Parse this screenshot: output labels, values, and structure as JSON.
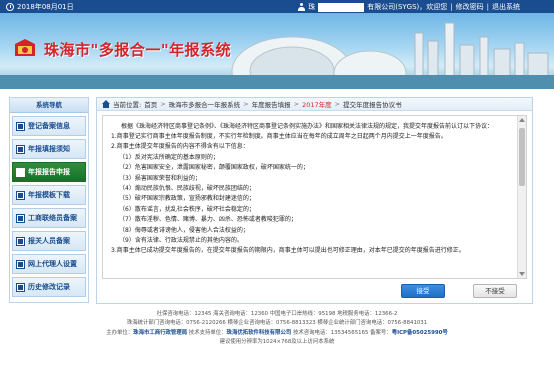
{
  "topbar": {
    "date": "2018年08月01日",
    "user_prefix": "珠",
    "user_suffix": "有限公司(SYGS)，欢迎您",
    "change_password": "修改密码",
    "logout": "退出系统"
  },
  "banner": {
    "title": "珠海市\"多报合一\"年报系统"
  },
  "sidebar": {
    "header": "系统导航",
    "items": [
      {
        "label": "登记备案信息",
        "active": false
      },
      {
        "label": "年报填报须知",
        "active": false
      },
      {
        "label": "年报报告申报",
        "active": true
      },
      {
        "label": "年报模板下载",
        "active": false
      },
      {
        "label": "工商联络员备案",
        "active": false
      },
      {
        "label": "报关人员备案",
        "active": false
      },
      {
        "label": "网上代理人设置",
        "active": false
      },
      {
        "label": "历史修改记录",
        "active": false
      }
    ]
  },
  "breadcrumb": {
    "prefix": "当前位置:",
    "items": [
      "首页",
      "珠海市多报合一年报系统",
      "年度报告填报",
      "2017年度",
      "提交年度报告协议书"
    ]
  },
  "agreement": {
    "lines": [
      "根据《珠海经济特区商事登记条例》、《珠海经济特区商事登记条例实施办法》和国家相关法律法规的规定，我提交年度报告前认订以下协议：",
      "1.商事登记实行商事主体年度报告制度，不实行年检制度。商事主体应当在每年的成立周年之日起两个月内提交上一年度报告。",
      "2.商事主体提交年度报告的内容不得含有以下信息：",
      "（1）反对宪法所确定的基本原则的；",
      "（2）危害国家安全，泄露国家秘密，颠覆国家政权，破坏国家统一的；",
      "（3）损害国家荣誉和利益的；",
      "（4）煽动民族仇恨、民族歧视，破坏民族团结的；",
      "（5）破坏国家宗教政策，宣扬邪教和封建迷信的；",
      "（6）散布谣言，扰乱社会秩序，破坏社会稳定的；",
      "（7）散布淫秽、色情、赌博、暴力、凶杀、恐怖或者教唆犯罪的；",
      "（8）侮辱或者诽谤他人，侵害他人合法权益的；",
      "（9）含有法律、行政法规禁止的其他内容的。",
      "3.商事主体已成功提交年度报告的，在提交年度报告的期限内，商事主体可以提出也可修正理由，对本年已提交的年度报告进行修正。"
    ]
  },
  "buttons": {
    "accept": "接受",
    "reject": "不接受"
  },
  "footer": {
    "line1": "社保咨询电话：12345  海关咨询电话：12360  中国电子口岸热线：95198  地税服务电话：12366-2",
    "line2": "珠海统计部门咨询电话：0756-2120266  横琴企业咨询电话：0756-8813323  横琴企业统计部门咨询电话：0756-8841031",
    "line3_label": "主办单位：",
    "line3_org": "珠海市工商行政管理局",
    "line3_support_label": "  技术支持单位：",
    "line3_support": "珠海优拓软件科技有限公司",
    "line3_rest": "  技术咨询电话：13534565165  备案号：",
    "line3_icp": "粤ICP备05025990号",
    "line4": "建议使用分辨率为1024×768及以上访问本系统"
  }
}
